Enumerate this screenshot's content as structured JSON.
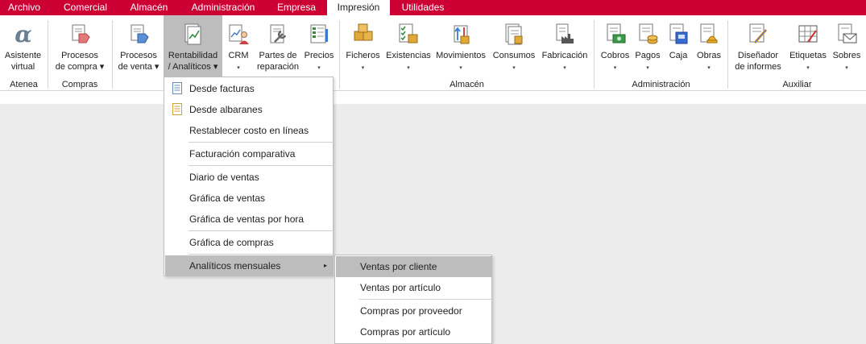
{
  "tabs": [
    "Archivo",
    "Comercial",
    "Almacén",
    "Administración",
    "Empresa",
    "Impresión",
    "Utilidades"
  ],
  "ribbon": {
    "buttons": [
      {
        "line1": "Asistente",
        "line2": "virtual"
      },
      {
        "line1": "Procesos",
        "line2": "de compra ▾"
      },
      {
        "line1": "Procesos",
        "line2": "de venta ▾"
      },
      {
        "line1": "Rentabilidad",
        "line2": "/ Analíticos ▾"
      },
      {
        "line1": "CRM",
        "line2": "▾"
      },
      {
        "line1": "Partes de",
        "line2": "reparación"
      },
      {
        "line1": "Precios",
        "line2": "▾"
      },
      {
        "line1": "Ficheros",
        "line2": "▾"
      },
      {
        "line1": "Existencias",
        "line2": "▾"
      },
      {
        "line1": "Movimientos",
        "line2": "▾"
      },
      {
        "line1": "Consumos",
        "line2": "▾"
      },
      {
        "line1": "Fabricación",
        "line2": "▾"
      },
      {
        "line1": "Cobros",
        "line2": "▾"
      },
      {
        "line1": "Pagos",
        "line2": "▾"
      },
      {
        "line1": "Caja",
        "line2": ""
      },
      {
        "line1": "Obras",
        "line2": "▾"
      },
      {
        "line1": "Diseñador",
        "line2": "de informes"
      },
      {
        "line1": "Etiquetas",
        "line2": "▾"
      },
      {
        "line1": "Sobres",
        "line2": "▾"
      }
    ],
    "groups": [
      "Atenea",
      "Compras",
      "Almacén",
      "Administración",
      "Auxiliar"
    ]
  },
  "menu": {
    "items": [
      "Desde facturas",
      "Desde albaranes",
      "Restablecer costo en líneas",
      "Facturación comparativa",
      "Diario de ventas",
      "Gráfica de ventas",
      "Gráfica de ventas por hora",
      "Gráfica de compras",
      "Analíticos mensuales"
    ],
    "submenu_arrow": "▸"
  },
  "submenu": {
    "items": [
      "Ventas por cliente",
      "Ventas por artículo",
      "Compras por proveedor",
      "Compras por artículo"
    ]
  },
  "colors": {
    "accent": "#cc0033",
    "highlight": "#bdbdbd"
  }
}
